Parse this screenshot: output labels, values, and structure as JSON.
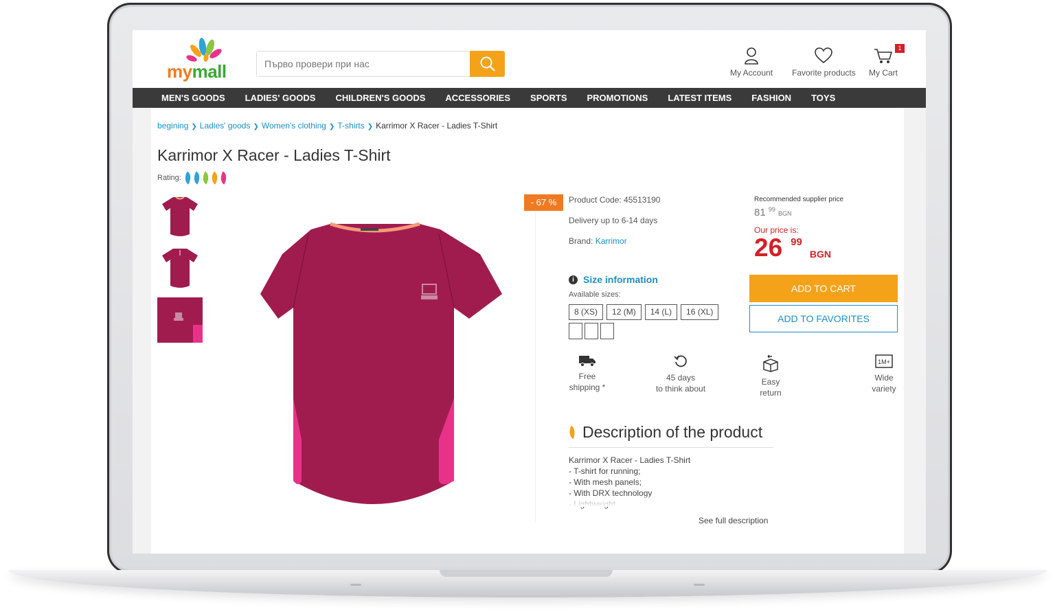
{
  "header": {
    "logo_text_my": "my",
    "logo_text_mall": "mall",
    "search_placeholder": "Първо провери при нас",
    "account_label": "My Account",
    "favorites_label": "Favorite products",
    "cart_label": "My Cart",
    "cart_count": "1"
  },
  "nav": {
    "items": [
      "MEN'S GOODS",
      "LADIES' GOODS",
      "CHILDREN'S GOODS",
      "ACCESSORIES",
      "SPORTS",
      "PROMOTIONS",
      "LATEST ITEMS",
      "FASHION",
      "TOYS"
    ]
  },
  "breadcrumb": {
    "items": [
      "begining",
      "Ladies' goods",
      "Women's clothing",
      "T-shirts"
    ],
    "current": "Karrimor X Racer - Ladies T-Shirt"
  },
  "product": {
    "title": "Karrimor X Racer - Ladies T-Shirt",
    "rating_label": "Rating:",
    "discount": "- 67 %",
    "code": "Product Code: 45513190",
    "delivery": "Delivery up to 6-14 days",
    "brand_label": "Brand:",
    "brand": "Karrimor",
    "size_info": "Size information",
    "available_sizes_label": "Available sizes:",
    "sizes": [
      "8 (XS)",
      "12 (M)",
      "14 (L)",
      "16 (XL)"
    ],
    "colors": {
      "shirt": "#a11c4e",
      "accent": "#f5a21b",
      "link": "#1a8fc9",
      "price": "#d32027"
    }
  },
  "features": {
    "shipping_line1": "Free",
    "shipping_line2": "shipping *",
    "think_line1": "45 days",
    "think_line2": "to think about",
    "return_line1": "Easy",
    "return_line2": "return",
    "variety_line1": "Wide",
    "variety_line2": "variety",
    "variety_icon_text": "1M+"
  },
  "price": {
    "recommended_label": "Recommended supplier price",
    "recommended_whole": "81",
    "recommended_cents": "99",
    "recommended_currency": "BGN",
    "our_label": "Our price is:",
    "our_whole": "26",
    "our_cents": "99",
    "our_currency": "BGN",
    "add_to_cart": "ADD TO CART",
    "add_to_favorites": "ADD TO FAVORITES"
  },
  "description": {
    "title": "Description of the product",
    "lines": [
      "Karrimor X Racer - Ladies T-Shirt",
      "- T-shirt for running;",
      "- With mesh panels;",
      "- With DRX technology",
      "- Lightweight"
    ],
    "see_full": "See full description"
  }
}
